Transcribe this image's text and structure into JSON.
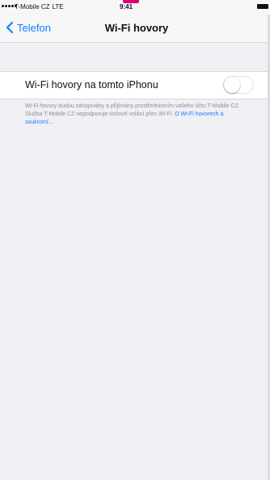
{
  "status_bar": {
    "carrier": "T-Mobile CZ",
    "network": "LTE",
    "time": "9:41"
  },
  "nav": {
    "back_label": "Telefon",
    "title": "Wi-Fi hovory"
  },
  "setting": {
    "label": "Wi-Fi hovory na tomto iPhonu",
    "toggle_on": false
  },
  "footer": {
    "text": "Wi-Fi hovory budou zahajovány a přijímány prostřednictvím vašeho účtu T-Mobile CZ. Služba T-Mobile CZ nepodporuje tísňové volání přes Wi-Fi. ",
    "link": "O Wi-Fi hovorech a soukromí…"
  },
  "colors": {
    "accent": "#157efb",
    "brand_marker": "#e20074",
    "background": "#efeff4"
  }
}
